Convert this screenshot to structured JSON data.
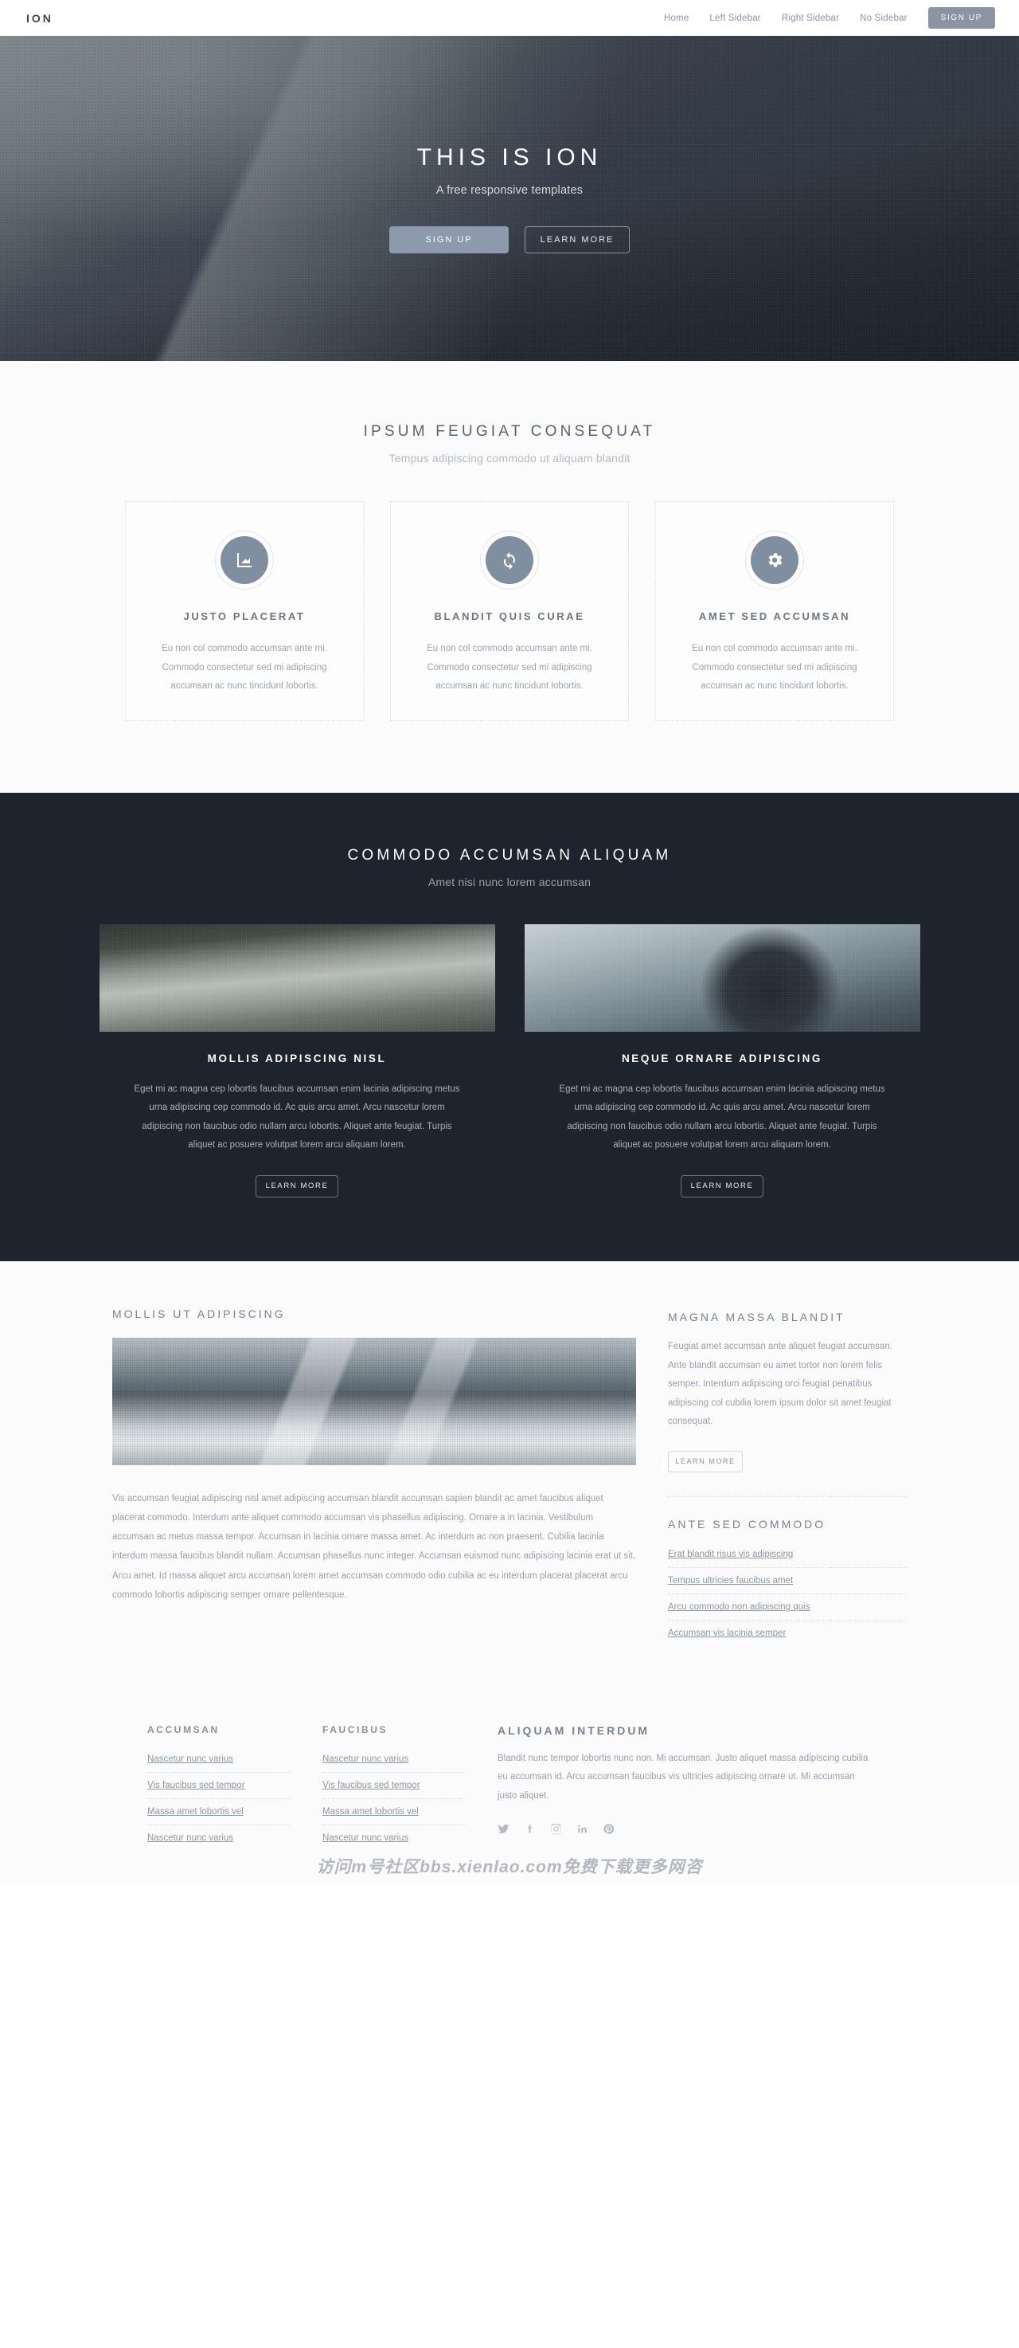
{
  "header": {
    "brand": "ION",
    "nav": [
      {
        "label": "Home"
      },
      {
        "label": "Left Sidebar"
      },
      {
        "label": "Right Sidebar"
      },
      {
        "label": "No Sidebar"
      }
    ],
    "signup_label": "SIGN UP"
  },
  "hero": {
    "title": "THIS IS ION",
    "subtitle": "A free responsive templates",
    "primary_button": "SIGN UP",
    "secondary_button": "LEARN MORE"
  },
  "features": {
    "title": "IPSUM FEUGIAT CONSEQUAT",
    "subtitle": "Tempus adipiscing commodo ut aliquam blandit",
    "cards": [
      {
        "icon": "image-icon",
        "title": "JUSTO PLACERAT",
        "text": "Eu non col commodo accumsan ante mi. Commodo consectetur sed mi adipiscing accumsan ac nunc tincidunt lobortis."
      },
      {
        "icon": "refresh-icon",
        "title": "BLANDIT QUIS CURAE",
        "text": "Eu non col commodo accumsan ante mi. Commodo consectetur sed mi adipiscing accumsan ac nunc tincidunt lobortis."
      },
      {
        "icon": "gear-icon",
        "title": "AMET SED ACCUMSAN",
        "text": "Eu non col commodo accumsan ante mi. Commodo consectetur sed mi adipiscing accumsan ac nunc tincidunt lobortis."
      }
    ]
  },
  "showcase": {
    "title": "COMMODO ACCUMSAN ALIQUAM",
    "subtitle": "Amet nisi nunc lorem accumsan",
    "cards": [
      {
        "image": "forest-boardwalk-photo",
        "title": "MOLLIS ADIPISCING NISL",
        "text": "Eget mi ac magna cep lobortis faucibus accumsan enim lacinia adipiscing metus urna adipiscing cep commodo id. Ac quis arcu amet. Arcu nascetur lorem adipiscing non faucibus odio nullam arcu lobortis. Aliquet ante feugiat. Turpis aliquet ac posuere volutpat lorem arcu aliquam lorem.",
        "button": "LEARN MORE"
      },
      {
        "image": "person-hoodie-photo",
        "title": "NEQUE ORNARE ADIPISCING",
        "text": "Eget mi ac magna cep lobortis faucibus accumsan enim lacinia adipiscing metus urna adipiscing cep commodo id. Ac quis arcu amet. Arcu nascetur lorem adipiscing non faucibus odio nullam arcu lobortis. Aliquet ante feugiat. Turpis aliquet ac posuere volutpat lorem arcu aliquam lorem.",
        "button": "LEARN MORE"
      }
    ]
  },
  "content": {
    "main_title": "MOLLIS UT ADIPISCING",
    "main_image": "snow-mountain-photo",
    "main_text": "Vis accumsan feugiat adipiscing nisl amet adipiscing accumsan blandit accumsan sapien blandit ac amet faucibus aliquet placerat commodo. Interdum ante aliquet commodo accumsan vis phasellus adipiscing. Ornare a in lacinia. Vestibulum accumsan ac metus massa tempor. Accumsan in lacinia ornare massa amet. Ac interdum ac non praesent. Cubilia lacinia interdum massa faucibus blandit nullam. Accumsan phasellus nunc integer. Accumsan euismod nunc adipiscing lacinia erat ut sit. Arcu amet. Id massa aliquet arcu accumsan lorem amet accumsan commodo odio cubilia ac eu interdum placerat placerat arcu commodo lobortis adipiscing semper ornare pellentesque.",
    "side_title": "MAGNA MASSA BLANDIT",
    "side_text": "Feugiat amet accumsan ante aliquet feugiat accumsan. Ante blandit accumsan eu amet tortor non lorem felis semper. Interdum adipiscing orci feugiat penatibus adipiscing col cubilia lorem ipsum dolor sit amet feugiat consequat.",
    "side_button": "LEARN MORE",
    "links_title": "ANTE SED COMMODO",
    "links": [
      {
        "label": "Erat blandit risus vis adipiscing"
      },
      {
        "label": "Tempus ultricies faucibus amet"
      },
      {
        "label": "Arcu commodo non adipiscing quis"
      },
      {
        "label": "Accumsan vis lacinia semper"
      }
    ]
  },
  "footer": {
    "columns": [
      {
        "title": "ACCUMSAN",
        "links": [
          {
            "label": "Nascetur nunc varius"
          },
          {
            "label": "Vis faucibus sed tempor"
          },
          {
            "label": "Massa amet lobortis vel"
          },
          {
            "label": "Nascetur nunc varius"
          }
        ]
      },
      {
        "title": "FAUCIBUS",
        "links": [
          {
            "label": "Nascetur nunc varius"
          },
          {
            "label": "Vis faucibus sed tempor"
          },
          {
            "label": "Massa amet lobortis vel"
          },
          {
            "label": "Nascetur nunc varius"
          }
        ]
      }
    ],
    "about_title": "ALIQUAM INTERDUM",
    "about_text": "Blandit nunc tempor lobortis nunc non. Mi accumsan. Justo aliquet massa adipiscing cubilia eu accumsan id. Arcu accumsan faucibus vis ultricies adipiscing ornare ut. Mi accumsan justo aliquet.",
    "socials": [
      {
        "name": "twitter-icon"
      },
      {
        "name": "facebook-icon"
      },
      {
        "name": "instagram-icon"
      },
      {
        "name": "linkedin-icon"
      },
      {
        "name": "pinterest-icon"
      }
    ]
  },
  "watermark": "访问m号社区bbs.xienlao.com免费下载更多网咨",
  "colors": {
    "accent": "#8d9aae",
    "dark": "#1d242d",
    "icon_circle": "#808f9f",
    "page_bg": "#fbfbfb"
  }
}
